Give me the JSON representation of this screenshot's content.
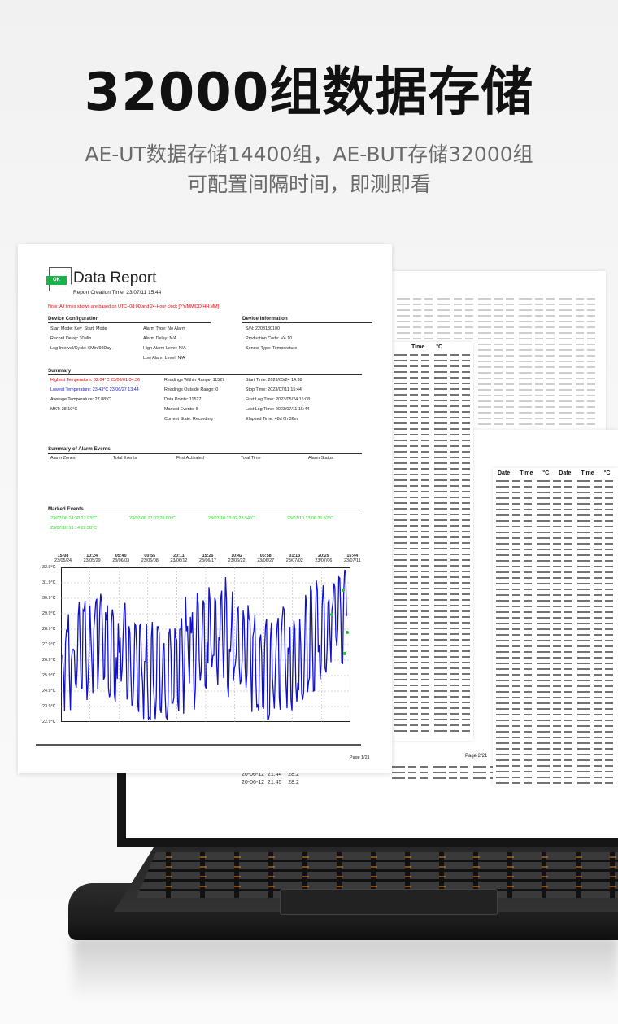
{
  "headline": "32000组数据存储",
  "subtitle_line1": "AE-UT数据存储14400组，AE-BUT存储32000组",
  "subtitle_line2": "可配置间隔时间，即测即看",
  "table_headers": [
    "Date",
    "Time",
    "°C"
  ],
  "page2_label": "Page 2/21",
  "back_rows": [
    {
      "date": "20-06-12",
      "time": "21:44",
      "temp": "28.2"
    },
    {
      "date": "20-06-12",
      "time": "21:45",
      "temp": "28.2"
    }
  ],
  "report": {
    "ok_badge": "OK",
    "title": "Data Report",
    "creation_time": "Report Creation Time: 23/07/11 15:44",
    "note": "Note: All times shown are based on UTC+08:00 and 24-Hour clock [YY/MM/DD HH:MM]",
    "device_config": {
      "heading": "Device Configuration",
      "items": [
        "Start Mode: Key_Start_Mode",
        "Record Delay: 30Min",
        "Log Interval/Cycle: 6Min/60Day",
        "Alarm Type: No Alarm",
        "Alarm Delay: N/A",
        "High Alarm Level: N/A",
        "Low Alarm Level: N/A"
      ]
    },
    "device_info": {
      "heading": "Device Information",
      "items": [
        "S/N: 2208130100",
        "Production Code: V4.10",
        "Sensor Type: Temperature"
      ]
    },
    "summary": {
      "heading": "Summary",
      "highest": "Highest Temperature: 32.04°C  23/06/01 04:36",
      "lowest": "Lowest Temperature: 23.43°C  23/06/27 13:44",
      "items": [
        "Average Temperature: 27.88°C",
        "MKT: 28.10°C",
        "Readings Within Range: 11527",
        "Readings Outside Range: 0",
        "Data Points: 11527",
        "Marked Events: 5",
        "Current State: Recording",
        "Start Time: 2023/05/24 14:38",
        "Stop Time: 2023/07/11 15:44",
        "First Log Time: 2023/05/24 15:08",
        "Last Log Time: 2023/07/11 15:44",
        "Elapsed Time: 48d 0h 36m"
      ]
    },
    "alarm_events": {
      "heading": "Summary of Alarm Events",
      "columns": [
        "Alarm Zones",
        "Total Events",
        "First Activated",
        "Total Time",
        "Alarm Status"
      ]
    },
    "marked_events": {
      "heading": "Marked Events",
      "items": [
        "23/07/08 14:38  27.93°C",
        "23/07/08 17:02  28.00°C",
        "23/07/10 13:02  28.54°C",
        "23/07/10 13:08  31.52°C",
        "23/07/10 13:14  29.50°C"
      ]
    },
    "chart": {
      "y_ticks": [
        "32.9°C",
        "31.9°C",
        "30.9°C",
        "29.9°C",
        "28.9°C",
        "27.9°C",
        "26.9°C",
        "25.9°C",
        "24.9°C",
        "23.9°C",
        "22.9°C"
      ],
      "x_ticks": [
        {
          "time": "15:08",
          "date": "23/05/24"
        },
        {
          "time": "10:24",
          "date": "23/05/29"
        },
        {
          "time": "05:40",
          "date": "23/06/03"
        },
        {
          "time": "00:55",
          "date": "23/06/08"
        },
        {
          "time": "20:11",
          "date": "23/06/12"
        },
        {
          "time": "15:26",
          "date": "23/06/17"
        },
        {
          "time": "10:42",
          "date": "23/06/22"
        },
        {
          "time": "05:58",
          "date": "23/06/27"
        },
        {
          "time": "01:13",
          "date": "23/07/02"
        },
        {
          "time": "20:29",
          "date": "23/07/06"
        },
        {
          "time": "15:44",
          "date": "23/07/11"
        }
      ],
      "line_color": "#1010d0",
      "marker_color": "#22c033"
    },
    "page_label": "Page 1/21"
  }
}
